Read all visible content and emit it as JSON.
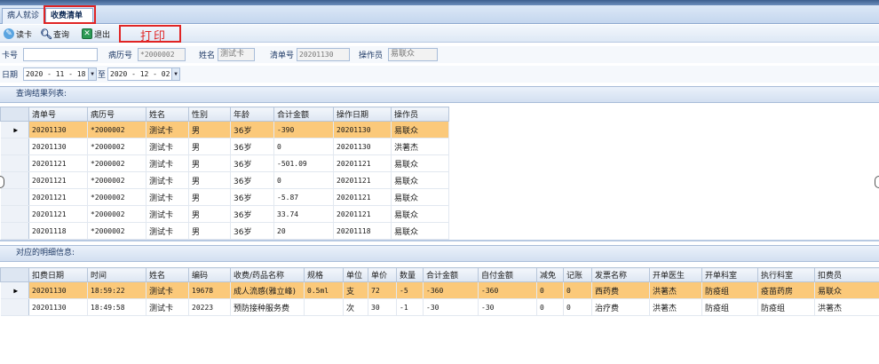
{
  "tabs": [
    {
      "label": "病人就诊"
    },
    {
      "label": "收费清单"
    }
  ],
  "toolbar": {
    "read_card": "读卡",
    "query": "查询",
    "exit": "退出",
    "print": "打印"
  },
  "form": {
    "card_label": "卡号",
    "card_value": "",
    "record_label": "病历号",
    "record_value": "*2000002",
    "name_label": "姓名",
    "name_value": "测试卡",
    "bill_label": "清单号",
    "bill_value": "20201130",
    "operator_label": "操作员",
    "operator_value": "易联众",
    "date_label": "日期",
    "date_from": "2020 - 11 - 18",
    "date_to_label": "至",
    "date_to": "2020 - 12 - 02"
  },
  "results": {
    "title": "查询结果列表:",
    "columns": [
      "清单号",
      "病历号",
      "姓名",
      "性别",
      "年龄",
      "合计金额",
      "操作日期",
      "操作员"
    ],
    "rows": [
      [
        "20201130",
        "*2000002",
        "测试卡",
        "男",
        "36岁",
        "-390",
        "20201130",
        "易联众"
      ],
      [
        "20201130",
        "*2000002",
        "测试卡",
        "男",
        "36岁",
        "0",
        "20201130",
        "洪著杰"
      ],
      [
        "20201121",
        "*2000002",
        "测试卡",
        "男",
        "36岁",
        "-501.09",
        "20201121",
        "易联众"
      ],
      [
        "20201121",
        "*2000002",
        "测试卡",
        "男",
        "36岁",
        "0",
        "20201121",
        "易联众"
      ],
      [
        "20201121",
        "*2000002",
        "测试卡",
        "男",
        "36岁",
        "-5.87",
        "20201121",
        "易联众"
      ],
      [
        "20201121",
        "*2000002",
        "测试卡",
        "男",
        "36岁",
        "33.74",
        "20201121",
        "易联众"
      ],
      [
        "20201118",
        "*2000002",
        "测试卡",
        "男",
        "36岁",
        "20",
        "20201118",
        "易联众"
      ]
    ]
  },
  "details": {
    "title": "对应的明细信息:",
    "columns": [
      "扣费日期",
      "时间",
      "姓名",
      "编码",
      "收费/药品名称",
      "规格",
      "单位",
      "单价",
      "数量",
      "合计金额",
      "自付金额",
      "减免",
      "记账",
      "发票名称",
      "开单医生",
      "开单科室",
      "执行科室",
      "扣费员"
    ],
    "rows": [
      [
        "20201130",
        "18:59:22",
        "测试卡",
        "19678",
        "成人流感(雅立峰)",
        "0.5ml",
        "支",
        "72",
        "-5",
        "-360",
        "-360",
        "0",
        "0",
        "西药费",
        "洪著杰",
        "防疫组",
        "疫苗药房",
        "易联众"
      ],
      [
        "20201130",
        "18:49:58",
        "测试卡",
        "20223",
        "预防接种服务费",
        "",
        "次",
        "30",
        "-1",
        "-30",
        "-30",
        "0",
        "0",
        "治疗费",
        "洪著杰",
        "防疫组",
        "防疫组",
        "洪著杰"
      ]
    ]
  },
  "colors": {
    "selected_row": "#fbc97a",
    "highlight_box": "#e02424",
    "header_bg": "#c4d6ee"
  }
}
